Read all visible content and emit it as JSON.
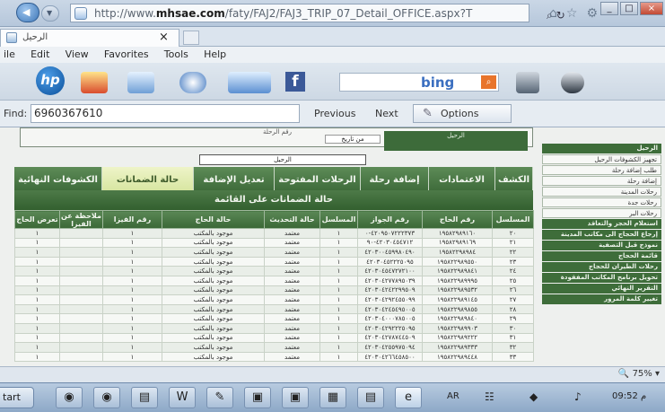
{
  "browser": {
    "url_prefix": "http://www.",
    "url_domain": "mhsae.com",
    "url_path": "/faty/FAJ2/FAJ3_TRIP_07_Detail_OFFICE.aspx?T",
    "tab_title": "الرحيل",
    "tab_close": "×",
    "window_controls": [
      "_",
      "□",
      "×"
    ],
    "icons": [
      "back-icon",
      "forward-icon",
      "search-icon",
      "refresh-icon",
      "home-icon",
      "star-icon",
      "gear-icon"
    ]
  },
  "menu": [
    "ile",
    "Edit",
    "View",
    "Favorites",
    "Tools",
    "Help"
  ],
  "favorites": {
    "hp": "hp",
    "facebook": "f",
    "bing": "bing"
  },
  "find": {
    "label": "Find:",
    "value": "6960367610",
    "previous": "Previous",
    "next": "Next",
    "options": "Options"
  },
  "content": {
    "top_label": "الرحيل",
    "top_field_value": "من تاريخ",
    "top_field_label": "رقم الرحلة",
    "select_value": "الرحيل",
    "tabs": [
      "الكشف",
      "الاعتمادات",
      "إضافة رحلة",
      "الرحلات المفتوحة",
      "تعديل الإضافة",
      "حالة الضمانات",
      "الكشوفات النهائية"
    ],
    "grid_title": "حالة الضمانات على القائمة",
    "columns": [
      "المسلسل",
      "رقم الحاج",
      "رقم الجواز",
      "المسلسل",
      "حالة التحديث",
      "حالة الحاج",
      "رقم الفيزا",
      "ملاحظة عن الفيزا",
      "تعرض الحاج"
    ],
    "rows": [
      [
        "٢٠",
        "١٩٥٨٢٩٨٩١٦٠",
        "٤٢٠٩٥٠٧٢٢٢٣٧٣-٠",
        "١",
        "معتمد",
        "موجود بالمكتب",
        "١",
        "",
        "١"
      ],
      [
        "٢١",
        "١٩٥٨٢٩٨٩١٦٩",
        "٤٢٠٣٠٤٥٤٧١٢-٩٠",
        "١",
        "معتمد",
        "موجود بالمكتب",
        "١",
        "",
        "١"
      ],
      [
        "٢٢",
        "١٩٥٨٢٢٩٨٩٨٤",
        "٤٢٠٣٠٠٤٥٩٩٨٠٤٩٠",
        "١",
        "معتمد",
        "موجود بالمكتب",
        "١",
        "",
        "١"
      ],
      [
        "٢٣",
        "١٩٥٨٢٢٩٨٩٥٥٠",
        "٤٢٠٣٠٤٥٢٢٢٥٠٩٥",
        "١",
        "معتمد",
        "موجود بالمكتب",
        "١",
        "",
        "١"
      ],
      [
        "٢٤",
        "١٩٥٨٢٢٩٨٩٨٤١",
        "٤٢٠٣٠٤٥٤٧٢٧٢١٠٠",
        "١",
        "معتمد",
        "موجود بالمكتب",
        "١",
        "",
        "١"
      ],
      [
        "٢٥",
        "١٩٥٨٢٢٩٨٩٩٩٥",
        "٤٢٠٣٠٤٢٧٧٨٩٥٠٣٩",
        "١",
        "معتمد",
        "موجود بالمكتب",
        "١",
        "",
        "١"
      ],
      [
        "٢٦",
        "١٩٥٨٢٢٩٨٩٥٣٢",
        "٤٢٠٣٠٤٢٤٢٢٩٩٥٠٩",
        "١",
        "معتمد",
        "موجود بالمكتب",
        "١",
        "",
        "١"
      ],
      [
        "٢٧",
        "١٩٥٨٢٢٩٨٩١٤٥",
        "٤٢٠٣٠٤٢٩٢٤٥٥٠٩٩",
        "١",
        "معتمد",
        "موجود بالمكتب",
        "١",
        "",
        "١"
      ],
      [
        "٢٨",
        "١٩٥٨٢٢٩٨٩٨٥٥",
        "٤٢٠٣٠٤٢٤٥٤٩٥٠٠٥",
        "١",
        "معتمد",
        "موجود بالمكتب",
        "١",
        "",
        "١"
      ],
      [
        "٢٩",
        "١٩٥٨٢٢٩٨٩٨٤٠",
        "٤٢٠٣٠٤٠٠٠٧٨٥٠٠٥",
        "١",
        "معتمد",
        "موجود بالمكتب",
        "١",
        "",
        "١"
      ],
      [
        "٣٠",
        "١٩٥٨٢٢٩٨٩٩٠٣",
        "٤٢٠٣٠٤٢٩٢٢٢٥٠٩٥",
        "١",
        "معتمد",
        "موجود بالمكتب",
        "١",
        "",
        "١"
      ],
      [
        "٣١",
        "١٩٥٨٢٢٩٨٩٢٢٢",
        "٤٢٠٣٠٤٢٧٨٧٤٤٥٠٩",
        "١",
        "معتمد",
        "موجود بالمكتب",
        "١",
        "",
        "١"
      ],
      [
        "٣٢",
        "١٩٥٨٢٢٩٨٩٣٣٣",
        "٤٢٠٣٠٤٢٥٥٩٧٥٠٩٤",
        "١",
        "معتمد",
        "موجود بالمكتب",
        "١",
        "",
        "١"
      ],
      [
        "٣٣",
        "١٩٥٨٢٢٩٨٩٤٤٨",
        "٤٢٠٣٠٤٢٦٦٤٥٨٥٠٠",
        "١",
        "معتمد",
        "موجود بالمكتب",
        "١",
        "",
        "١"
      ]
    ],
    "sidebar": [
      {
        "label": "الرحيل",
        "style": "green"
      },
      {
        "label": "تجهيز الكشوفات الرحيل",
        "style": "light"
      },
      {
        "label": "طلب إضافة رحلة",
        "style": "light"
      },
      {
        "label": "إضافة رحلة",
        "style": "light"
      },
      {
        "label": "رحلات المدينة",
        "style": "light"
      },
      {
        "label": "رحلات جدة",
        "style": "light"
      },
      {
        "label": "رحلات البر",
        "style": "light"
      },
      {
        "label": "استعلام الحجز والتعاقد",
        "style": "green"
      },
      {
        "label": "إرجاع الحجاج الى مكاتب المدينة",
        "style": "green"
      },
      {
        "label": "نموذج قبل التصفية",
        "style": "green"
      },
      {
        "label": "قائمة الحجاج",
        "style": "green"
      },
      {
        "label": "رحلات الطيران للحجاج",
        "style": "green"
      },
      {
        "label": "تحويل برنامج المكاتب المفقودة",
        "style": "green"
      },
      {
        "label": "التقرير النهائي",
        "style": "green"
      },
      {
        "label": "تغيير كلمة المرور",
        "style": "green"
      }
    ]
  },
  "status": {
    "zoom": "75%"
  },
  "taskbar": {
    "start": "tart",
    "lang": "AR",
    "clock": "09:52 م"
  }
}
